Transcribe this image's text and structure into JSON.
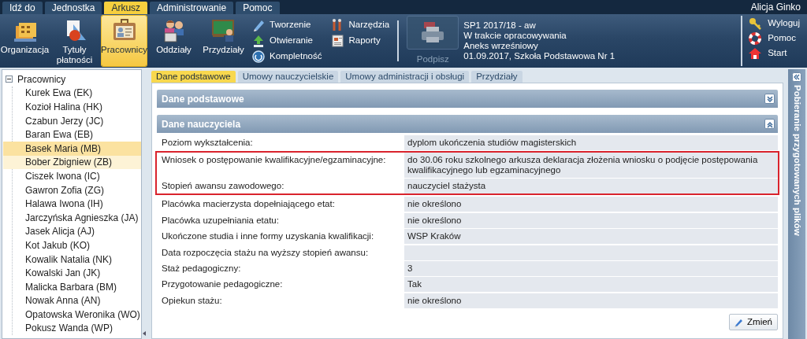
{
  "menu_tabs": [
    {
      "label": "Idź do",
      "selected": false
    },
    {
      "label": "Jednostka",
      "selected": false
    },
    {
      "label": "Arkusz",
      "selected": true
    },
    {
      "label": "Administrowanie",
      "selected": false
    },
    {
      "label": "Pomoc",
      "selected": false
    }
  ],
  "user_name": "Alicja Ginko",
  "ribbon": {
    "large_buttons": [
      {
        "label": "Organizacja",
        "selected": false
      },
      {
        "label": "Tytuły płatności",
        "selected": false
      },
      {
        "label": "Pracownicy",
        "selected": true
      },
      {
        "label": "Oddziały",
        "selected": false
      },
      {
        "label": "Przydziały",
        "selected": false
      }
    ],
    "small_buttons": [
      {
        "label": "Tworzenie"
      },
      {
        "label": "Otwieranie"
      },
      {
        "label": "Kompletność"
      },
      {
        "label": "Narzędzia"
      },
      {
        "label": "Raporty"
      }
    ],
    "sign_button": {
      "label": "Podpisz",
      "disabled": true
    },
    "info_lines": [
      "SP1 2017/18 - aw",
      "W trakcie opracowywania",
      "Aneks wrześniowy",
      "01.09.2017, Szkoła Podstawowa Nr 1"
    ],
    "side_buttons": [
      {
        "label": "Wyloguj"
      },
      {
        "label": "Pomoc"
      },
      {
        "label": "Start"
      }
    ]
  },
  "sidebar": {
    "root": {
      "label": "Pracownicy",
      "expanded": true,
      "children": [
        {
          "label": "Kurek Ewa (EK)",
          "selected": false,
          "hovered": false
        },
        {
          "label": "Kozioł Halina (HK)",
          "selected": false,
          "hovered": false
        },
        {
          "label": "Czabun Jerzy (JC)",
          "selected": false,
          "hovered": false
        },
        {
          "label": "Baran Ewa (EB)",
          "selected": false,
          "hovered": false
        },
        {
          "label": "Basek Maria (MB)",
          "selected": true,
          "hovered": false
        },
        {
          "label": "Bober Zbigniew (ZB)",
          "selected": false,
          "hovered": true
        },
        {
          "label": "Ciszek Iwona (IC)",
          "selected": false,
          "hovered": false
        },
        {
          "label": "Gawron Zofia (ZG)",
          "selected": false,
          "hovered": false
        },
        {
          "label": "Halawa Iwona (IH)",
          "selected": false,
          "hovered": false
        },
        {
          "label": "Jarczyńska Agnieszka (JA)",
          "selected": false,
          "hovered": false
        },
        {
          "label": "Jasek Alicja (AJ)",
          "selected": false,
          "hovered": false
        },
        {
          "label": "Kot Jakub (KO)",
          "selected": false,
          "hovered": false
        },
        {
          "label": "Kowalik Natalia (NK)",
          "selected": false,
          "hovered": false
        },
        {
          "label": "Kowalski Jan (JK)",
          "selected": false,
          "hovered": false
        },
        {
          "label": "Malicka Barbara (BM)",
          "selected": false,
          "hovered": false
        },
        {
          "label": "Nowak Anna (AN)",
          "selected": false,
          "hovered": false
        },
        {
          "label": "Opatowska Weronika (WO)",
          "selected": false,
          "hovered": false
        },
        {
          "label": "Pokusz Wanda (WP)",
          "selected": false,
          "hovered": false
        }
      ]
    }
  },
  "content_tabs": [
    {
      "label": "Dane podstawowe",
      "selected": true
    },
    {
      "label": "Umowy nauczycielskie",
      "selected": false
    },
    {
      "label": "Umowy administracji i obsługi",
      "selected": false
    },
    {
      "label": "Przydziały",
      "selected": false
    }
  ],
  "panels": [
    {
      "title": "Dane podstawowe",
      "expanded": false
    },
    {
      "title": "Dane nauczyciela",
      "expanded": true,
      "fields": [
        {
          "label": "Poziom wykształcenia:",
          "value": "dyplom ukończenia studiów magisterskich",
          "highlighted": false
        },
        {
          "label": "Wniosek o postępowanie kwalifikacyjne/egzaminacyjne:",
          "value": "do 30.06 roku szkolnego arkusza deklaracja złożenia wniosku o podjęcie postępowania kwalifikacyjnego lub egzaminacyjnego",
          "highlighted": true
        },
        {
          "label": "Stopień awansu zawodowego:",
          "value": "nauczyciel stażysta",
          "highlighted": true
        },
        {
          "label": "Placówka macierzysta dopełniającego etat:",
          "value": "nie określono",
          "highlighted": false
        },
        {
          "label": "Placówka uzupełniania etatu:",
          "value": "nie określono",
          "highlighted": false
        },
        {
          "label": "Ukończone studia i inne formy uzyskania kwalifikacji:",
          "value": "WSP Kraków",
          "highlighted": false
        },
        {
          "label": "Data rozpoczęcia stażu na wyższy stopień awansu:",
          "highlighted": false
        },
        {
          "label": "Staż pedagogiczny:",
          "value": "3",
          "highlighted": false
        },
        {
          "label": "Przygotowanie pedagogiczne:",
          "value": "Tak",
          "highlighted": false
        },
        {
          "label": "Opiekun stażu:",
          "value": "nie określono",
          "highlighted": false
        }
      ],
      "edit_button": "Zmień"
    }
  ],
  "right_panel": {
    "title": "Pobieranie przygotowanych plików"
  }
}
